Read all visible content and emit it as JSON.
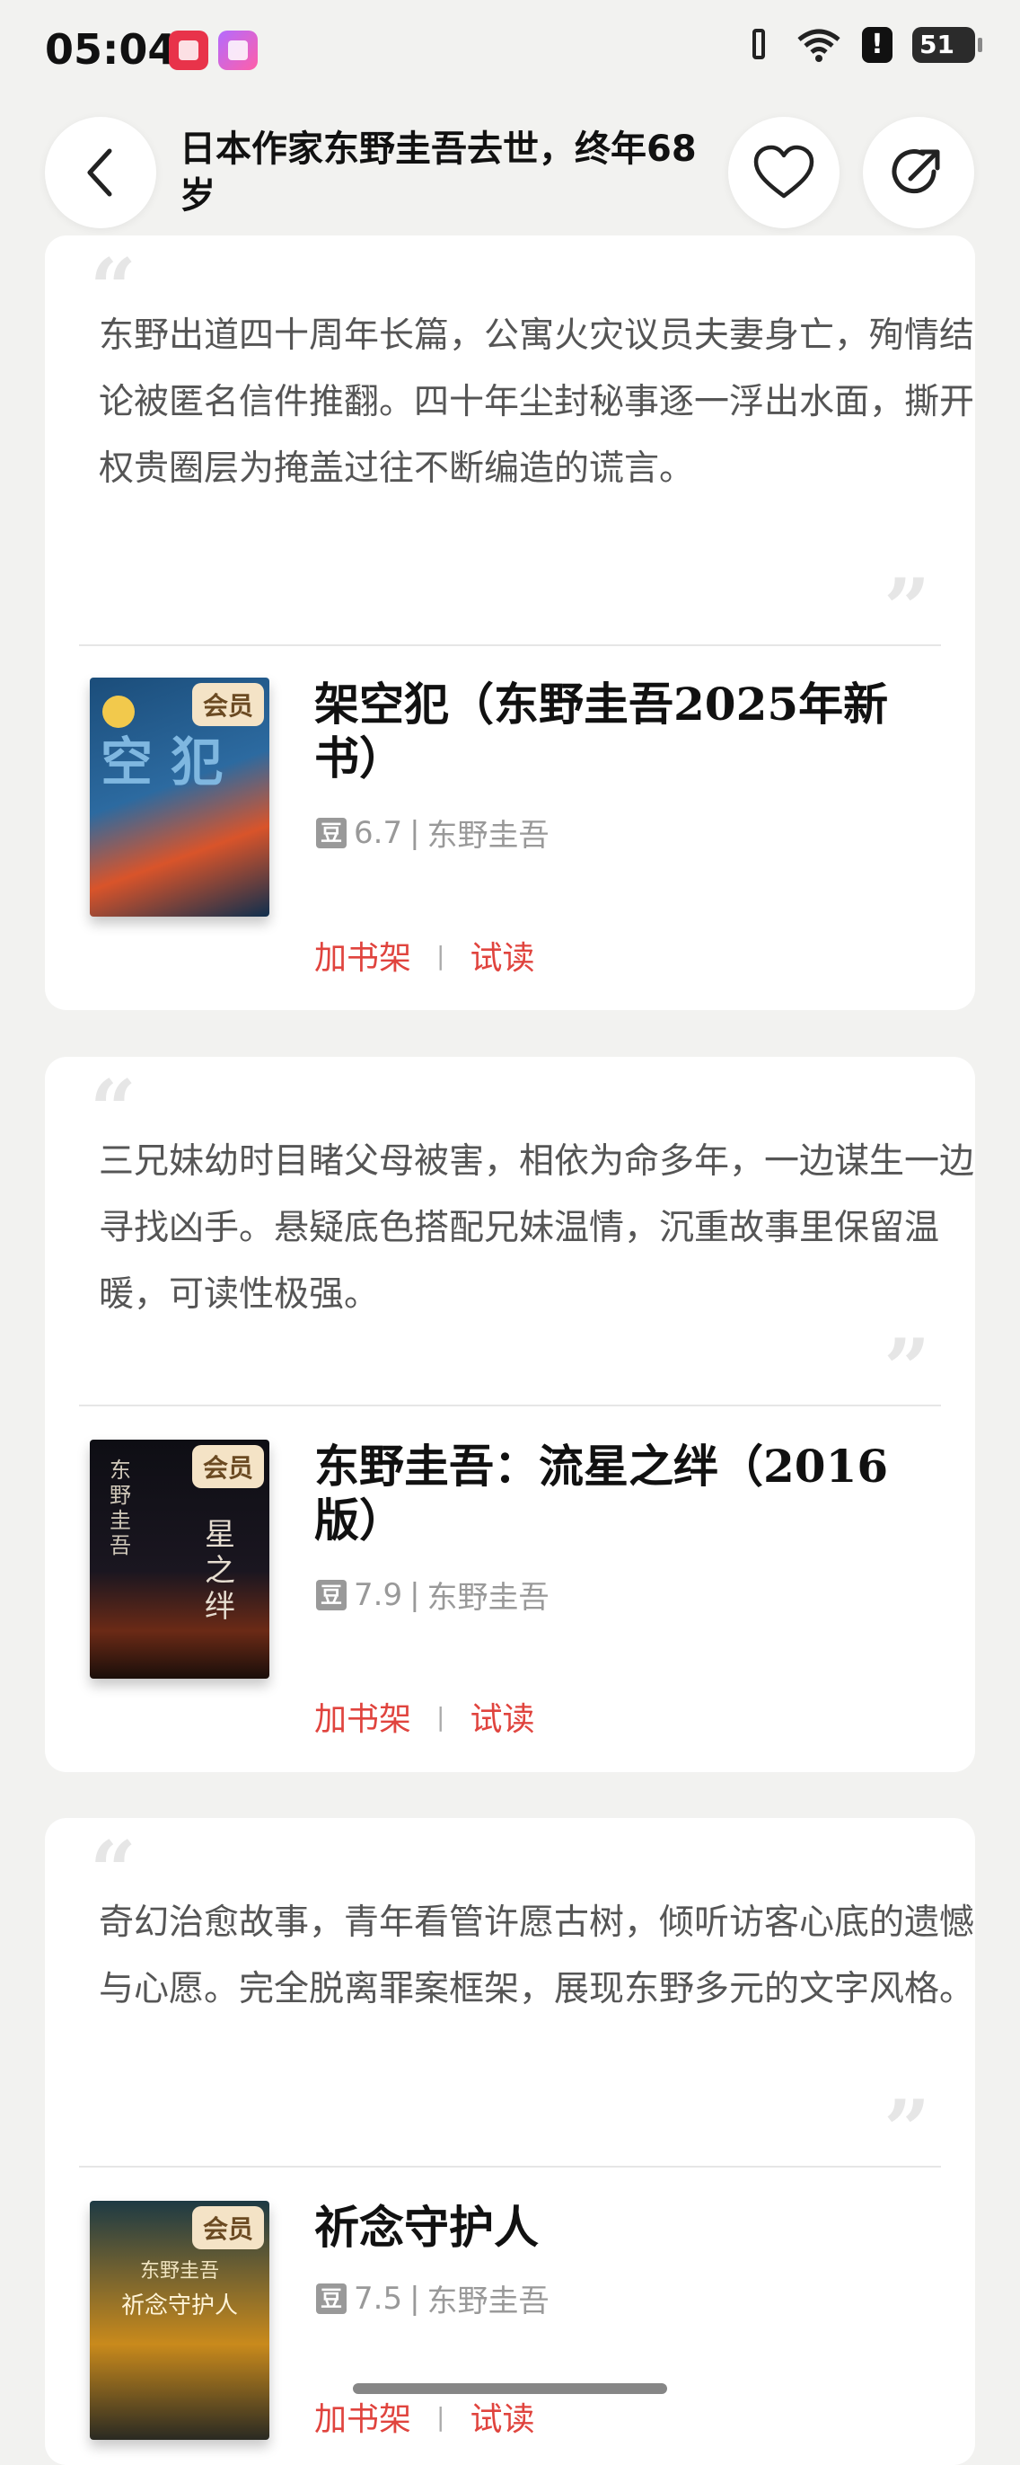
{
  "status_bar": {
    "time": "05:04",
    "alert": "!",
    "battery": "51"
  },
  "header": {
    "title": "日本作家东野圭吾去世，终年68岁"
  },
  "cards": [
    {
      "quote": "东野出道四十周年长篇，公寓火灾议员夫妻身亡，殉情结论被匿名信件推翻。四十年尘封秘事逐一浮出水面，撕开权贵圈层为掩盖过往不断编造的谎言。",
      "title": "架空犯（东野圭吾2025年新书）",
      "rating": "6.7",
      "author": "东野圭吾",
      "badge": "会员",
      "add_shelf": "加书架",
      "separator": "|",
      "trial": "试读",
      "cover_text": "空 犯"
    },
    {
      "quote": "三兄妹幼时目睹父母被害，相依为命多年，一边谋生一边寻找凶手。悬疑底色搭配兄妹温情，沉重故事里保留温暖，可读性极强。",
      "title": "东野圭吾：流星之绊（2016版）",
      "rating": "7.9",
      "author": "东野圭吾",
      "badge": "会员",
      "add_shelf": "加书架",
      "separator": "|",
      "trial": "试读",
      "cover_text": "星之绊"
    },
    {
      "quote": "奇幻治愈故事，青年看管许愿古树，倾听访客心底的遗憾与心愿。完全脱离罪案框架，展现东野多元的文字风格。",
      "title": "祈念守护人",
      "rating": "7.5",
      "author": "东野圭吾",
      "badge": "会员",
      "add_shelf": "加书架",
      "separator": "|",
      "trial": "试读",
      "cover_text": "祈念守护人"
    }
  ],
  "labels": {
    "douban": "豆",
    "meta_sep": "|",
    "quote_open": "“",
    "quote_close": "”"
  },
  "colors": {
    "accent": "#e0443e",
    "background": "#f2f2f0",
    "badge_bg": "#f4e3c6"
  }
}
